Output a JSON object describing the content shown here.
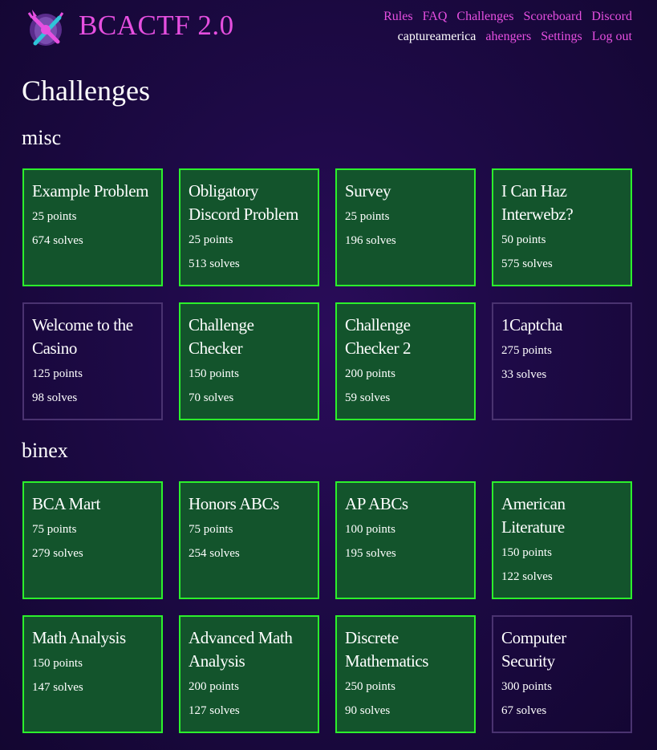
{
  "brand": {
    "title": "BCACTF 2.0"
  },
  "nav": {
    "links": [
      "Rules",
      "FAQ",
      "Challenges",
      "Scoreboard",
      "Discord"
    ],
    "user": "captureamerica",
    "account": [
      "ahengers",
      "Settings",
      "Log out"
    ]
  },
  "page_title": "Challenges",
  "colors": {
    "accent": "#e64fe0",
    "solved_border": "#2cf02c",
    "solved_bg": "#13542c",
    "unsolved_border": "#4a3370"
  },
  "sections": [
    {
      "title": "misc",
      "challenges": [
        {
          "name": "Example Problem",
          "points": "25 points",
          "solves": "674 solves",
          "solved": true
        },
        {
          "name": "Obligatory Discord Problem",
          "points": "25 points",
          "solves": "513 solves",
          "solved": true
        },
        {
          "name": "Survey",
          "points": "25 points",
          "solves": "196 solves",
          "solved": true
        },
        {
          "name": "I Can Haz Interwebz?",
          "points": "50 points",
          "solves": "575 solves",
          "solved": true
        },
        {
          "name": "Welcome to the Casino",
          "points": "125 points",
          "solves": "98 solves",
          "solved": false
        },
        {
          "name": "Challenge Checker",
          "points": "150 points",
          "solves": "70 solves",
          "solved": true
        },
        {
          "name": "Challenge Checker 2",
          "points": "200 points",
          "solves": "59 solves",
          "solved": true
        },
        {
          "name": "1Captcha",
          "points": "275 points",
          "solves": "33 solves",
          "solved": false
        }
      ]
    },
    {
      "title": "binex",
      "challenges": [
        {
          "name": "BCA Mart",
          "points": "75 points",
          "solves": "279 solves",
          "solved": true
        },
        {
          "name": "Honors ABCs",
          "points": "75 points",
          "solves": "254 solves",
          "solved": true
        },
        {
          "name": "AP ABCs",
          "points": "100 points",
          "solves": "195 solves",
          "solved": true
        },
        {
          "name": "American Literature",
          "points": "150 points",
          "solves": "122 solves",
          "solved": true
        },
        {
          "name": "Math Analysis",
          "points": "150 points",
          "solves": "147 solves",
          "solved": true
        },
        {
          "name": "Advanced Math Analysis",
          "points": "200 points",
          "solves": "127 solves",
          "solved": true
        },
        {
          "name": "Discrete Mathematics",
          "points": "250 points",
          "solves": "90 solves",
          "solved": true
        },
        {
          "name": "Computer Security",
          "points": "300 points",
          "solves": "67 solves",
          "solved": false
        }
      ]
    }
  ]
}
